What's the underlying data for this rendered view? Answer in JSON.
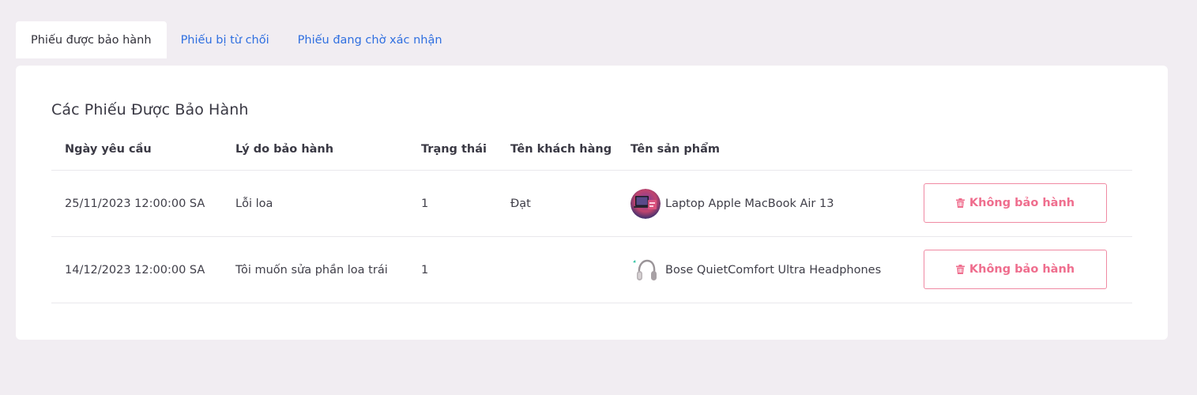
{
  "tabs": [
    {
      "label": "Phiếu được bảo hành",
      "active": true
    },
    {
      "label": "Phiếu bị từ chối",
      "active": false
    },
    {
      "label": "Phiếu đang chờ xác nhận",
      "active": false
    }
  ],
  "card": {
    "title": "Các Phiếu Được Bảo Hành"
  },
  "table": {
    "headers": [
      "Ngày yêu cầu",
      "Lý do bảo hành",
      "Trạng thái",
      "Tên khách hàng",
      "Tên sản phẩm"
    ],
    "rows": [
      {
        "date": "25/11/2023 12:00:00 SA",
        "reason": "Lỗi loa",
        "status": "1",
        "customer": "Đạt",
        "product": "Laptop Apple MacBook Air 13",
        "product_icon": "laptop-thumbnail",
        "action": "Không bảo hành"
      },
      {
        "date": "14/12/2023 12:00:00 SA",
        "reason": "Tôi muốn sửa phần loa trái",
        "status": "1",
        "customer": "",
        "product": "Bose QuietComfort Ultra Headphones",
        "product_icon": "headphones-thumbnail",
        "action": "Không bảo hành"
      }
    ]
  },
  "colors": {
    "background": "#f1edf2",
    "tab_link": "#2f6fe0",
    "danger": "#ef6e8e"
  }
}
